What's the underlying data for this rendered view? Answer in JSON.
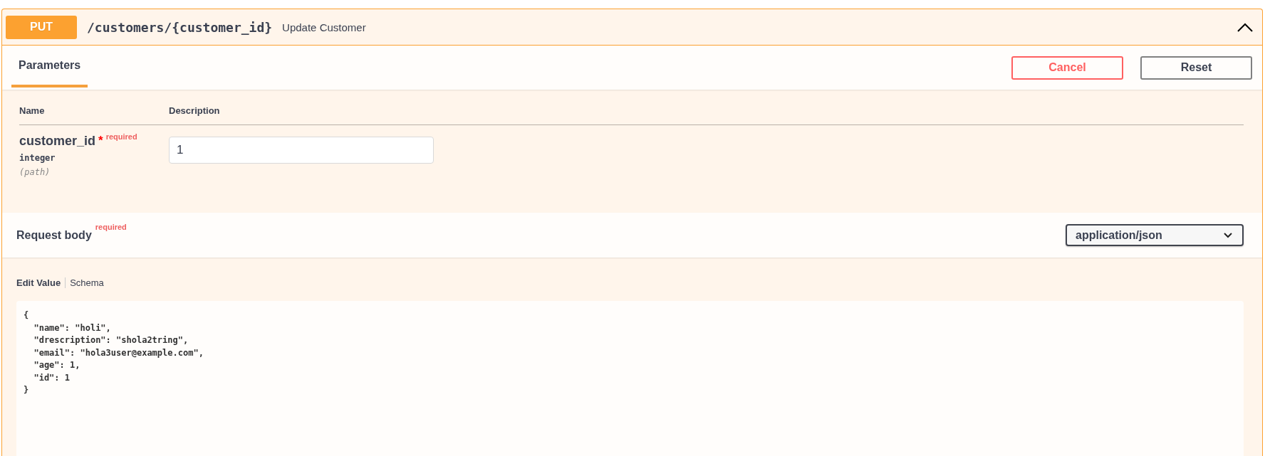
{
  "operation": {
    "method": "PUT",
    "path": "/customers/{customer_id}",
    "summary": "Update Customer",
    "expanded": true
  },
  "tabs": [
    {
      "label": "Parameters",
      "selected": true
    }
  ],
  "buttons": [
    {
      "label": "Cancel",
      "kind": "cancel"
    },
    {
      "label": "Reset",
      "kind": "reset"
    }
  ],
  "parameters": {
    "columns": [
      "Name",
      "Description"
    ],
    "rows": [
      {
        "name": "customer_id",
        "required_mark": "*",
        "required_label": "required",
        "type": "integer",
        "location": "(path)",
        "value": "1"
      }
    ]
  },
  "request_body": {
    "title": "Request body",
    "required_label": "required",
    "content_type": "application/json",
    "tabs": [
      {
        "label": "Edit Value",
        "selected": true
      },
      {
        "label": "Schema",
        "selected": false
      }
    ],
    "value": "{\n  \"name\": \"holi\",\n  \"drescription\": \"shola2tring\",\n  \"email\": \"hola3user@example.com\",\n  \"age\": 1,\n  \"id\": 1\n}"
  }
}
